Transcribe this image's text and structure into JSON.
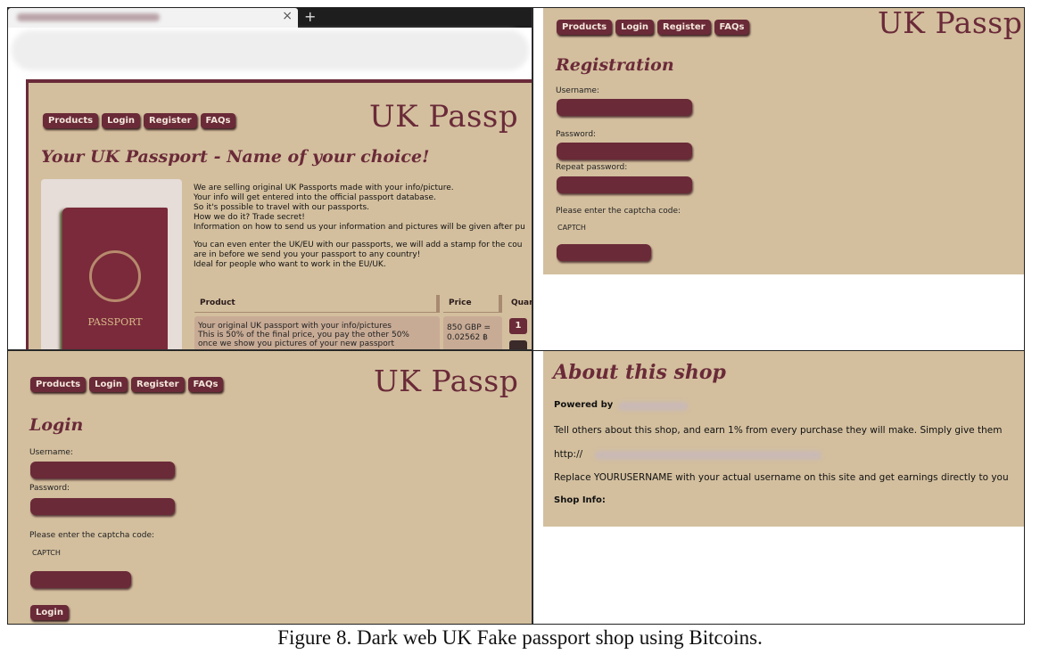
{
  "nav": [
    "Products",
    "Login",
    "Register",
    "FAQs"
  ],
  "brand": "UK Passp",
  "browser": {
    "close_icon": "×",
    "newtab_icon": "+"
  },
  "main": {
    "heading": "Your UK Passport - Name of your choice!",
    "paragraph1": [
      "We are selling original UK Passports made with your info/picture.",
      "Your info will get entered into the official passport database.",
      "So it's possible to travel with our passports.",
      "How we do it? Trade secret!",
      "Information on how to send us your information and pictures will be given after pu"
    ],
    "paragraph2": [
      "You can even enter the UK/EU with our passports, we will add a stamp for the cou",
      "are in before we send you your passport to any country!",
      "Ideal for people who want to work in the EU/UK."
    ],
    "table_headers": [
      "Product",
      "Price",
      "Quan"
    ],
    "product_lines": [
      "Your original UK passport with your info/pictures",
      "This is 50% of the final price, you pay the other 50%",
      "once we show you pictures of your new passport"
    ],
    "price_lines": [
      "850 GBP =",
      "0.02562 ฿"
    ],
    "quantity": "1",
    "passport_cover": "PASSPORT"
  },
  "registration": {
    "heading": "Registration",
    "username_label": "Username:",
    "password_label": "Password:",
    "repeat_label": "Repeat password:",
    "captcha_label": "Please enter the captcha code:",
    "captcha_text": "CAPTCH"
  },
  "login": {
    "heading": "Login",
    "username_label": "Username:",
    "password_label": "Password:",
    "captcha_label": "Please enter the captcha code:",
    "captcha_text": "CAPTCH",
    "button": "Login"
  },
  "about": {
    "heading": "About this shop",
    "powered_by": "Powered by",
    "referral_text": "Tell others about this shop, and earn 1% from every purchase they will make. Simply give them",
    "link_prefix": "http://",
    "replace_text": "Replace YOURUSERNAME with your actual username on this site and get earnings directly to you",
    "shop_info": "Shop Info:"
  },
  "caption": "Figure 8. Dark web UK Fake passport shop using Bitcoins."
}
